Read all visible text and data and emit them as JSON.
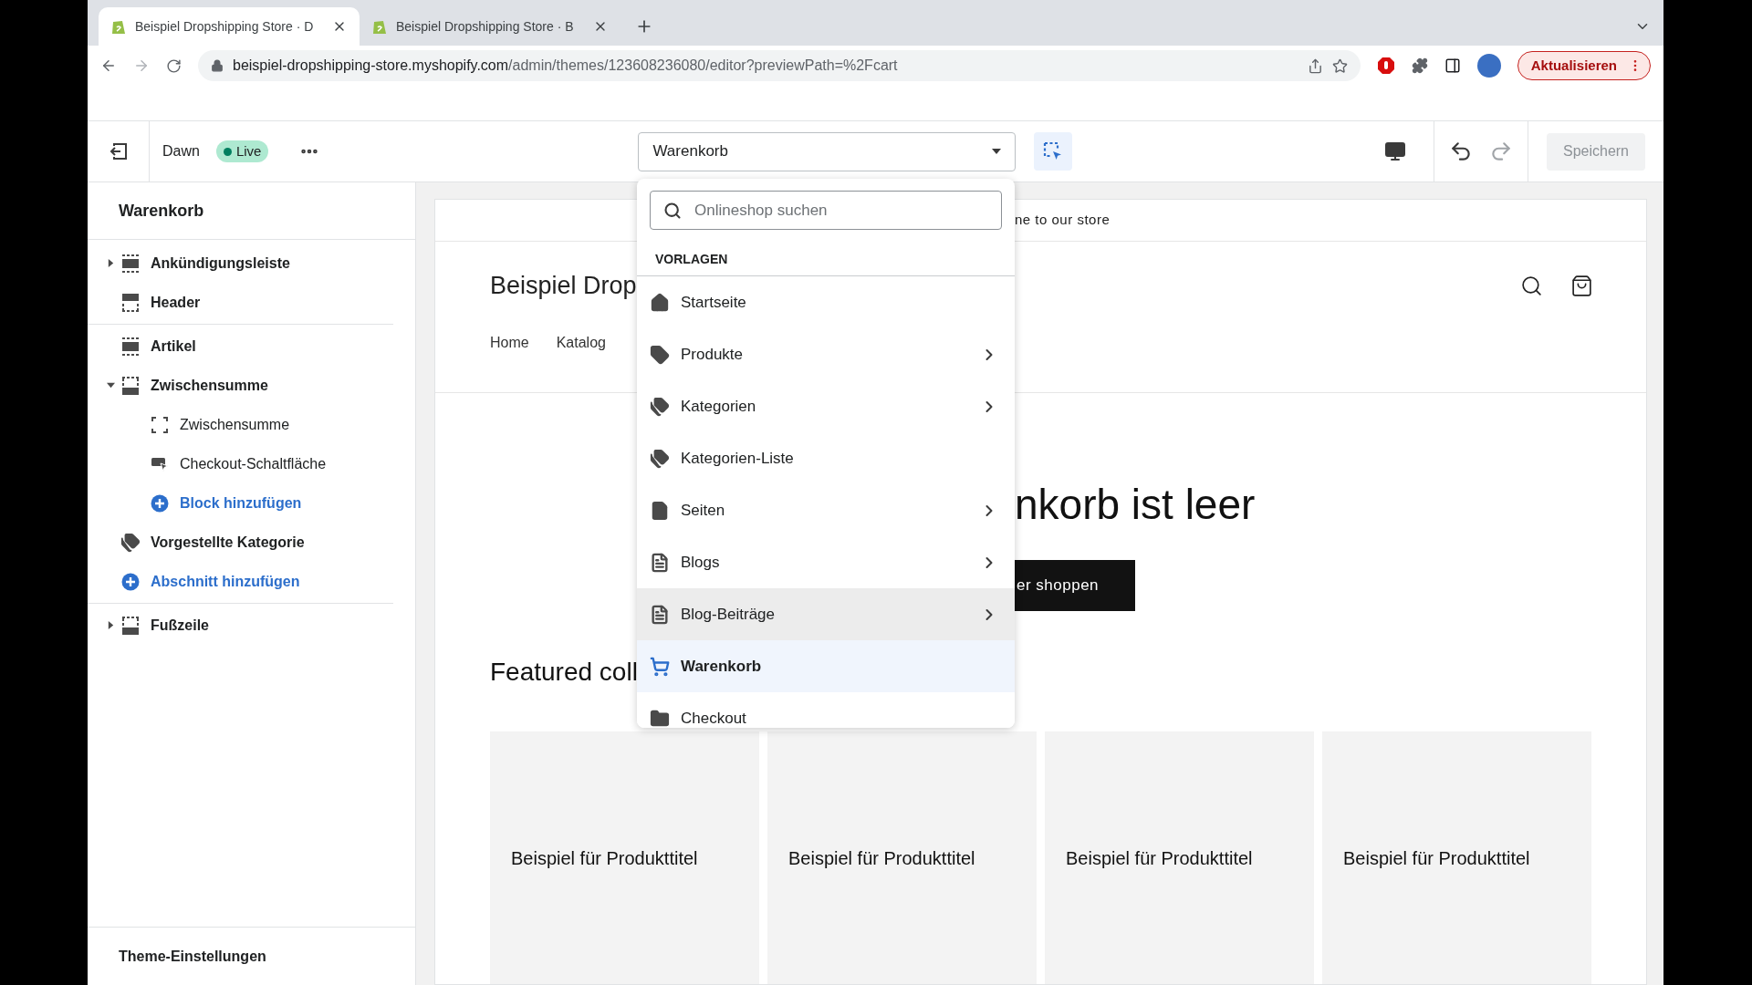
{
  "browser": {
    "tabs": [
      {
        "title": "Beispiel Dropshipping Store · D",
        "selected": true
      },
      {
        "title": "Beispiel Dropshipping Store · B",
        "selected": false
      }
    ],
    "url_host": "beispiel-dropshipping-store.myshopify.com",
    "url_path": "/admin/themes/123608236080/editor?previewPath=%2Fcart",
    "update_button": "Aktualisieren"
  },
  "editor_bar": {
    "theme": "Dawn",
    "status": "Live",
    "template_select": "Warenkorb",
    "inspector_active": true,
    "save_button": "Speichern",
    "save_disabled": true
  },
  "sidebar": {
    "title": "Warenkorb",
    "groups": [
      [
        {
          "label": "Ankündigungsleiste",
          "kind": "band",
          "expanded": false
        },
        {
          "label": "Header",
          "kind": "header"
        }
      ],
      [
        {
          "label": "Artikel",
          "kind": "band"
        },
        {
          "label": "Zwischensumme",
          "kind": "footer",
          "expanded": true,
          "children": [
            {
              "label": "Zwischensumme",
              "kind": "block"
            },
            {
              "label": "Checkout-Schaltfläche",
              "kind": "button-block"
            },
            {
              "label": "Block hinzufügen",
              "kind": "add"
            }
          ]
        },
        {
          "label": "Vorgestellte Kategorie",
          "kind": "collection"
        },
        {
          "label": "Abschnitt hinzufügen",
          "kind": "add"
        }
      ],
      [
        {
          "label": "Fußzeile",
          "kind": "footer",
          "expanded": false
        }
      ]
    ],
    "footer": "Theme-Einstellungen"
  },
  "dropdown": {
    "search_placeholder": "Onlineshop suchen",
    "heading": "VORLAGEN",
    "items": [
      {
        "label": "Startseite",
        "kind": "home",
        "submenu": false,
        "hovered": false,
        "selected": false
      },
      {
        "label": "Produkte",
        "kind": "tag",
        "submenu": true,
        "hovered": false,
        "selected": false
      },
      {
        "label": "Kategorien",
        "kind": "collection",
        "submenu": true,
        "hovered": false,
        "selected": false
      },
      {
        "label": "Kategorien-Liste",
        "kind": "collection",
        "submenu": false,
        "hovered": false,
        "selected": false
      },
      {
        "label": "Seiten",
        "kind": "page",
        "submenu": true,
        "hovered": false,
        "selected": false
      },
      {
        "label": "Blogs",
        "kind": "blog",
        "submenu": true,
        "hovered": false,
        "selected": false
      },
      {
        "label": "Blog-Beiträge",
        "kind": "blog",
        "submenu": true,
        "hovered": true,
        "selected": false
      },
      {
        "label": "Warenkorb",
        "kind": "cart",
        "submenu": false,
        "hovered": false,
        "selected": true
      },
      {
        "label": "Checkout",
        "kind": "folder",
        "submenu": false,
        "hovered": false,
        "selected": false
      }
    ]
  },
  "preview": {
    "announcement": "ne to our store",
    "store_name": "Beispiel Drop",
    "nav": [
      "Home",
      "Katalog"
    ],
    "empty_title": "nkorb ist leer",
    "continue_button": "er shoppen",
    "featured_title": "Featured coll",
    "products": [
      "Beispiel für Produkttitel",
      "Beispiel für Produkttitel",
      "Beispiel für Produkttitel",
      "Beispiel für Produkttitel"
    ]
  }
}
